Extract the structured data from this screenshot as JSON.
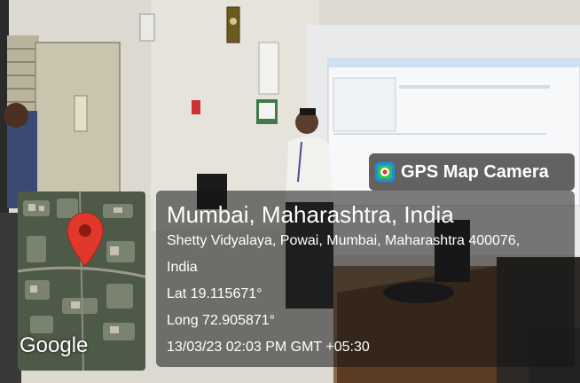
{
  "overlay": {
    "app_label": "GPS Map Camera",
    "app_icon": "gps-map-camera-icon",
    "map_provider": "Google",
    "location_title": "Mumbai, Maharashtra, India",
    "address_line1": "Shetty Vidyalaya, Powai, Mumbai, Maharashtra 400076,",
    "address_line2": "India",
    "latitude": "Lat 19.115671°",
    "longitude": "Long 72.905871°",
    "datetime": "13/03/23 02:03 PM GMT +05:30"
  },
  "colors": {
    "pin": "#e0392b",
    "panel": "#1e1e1e",
    "text": "#ffffff"
  }
}
